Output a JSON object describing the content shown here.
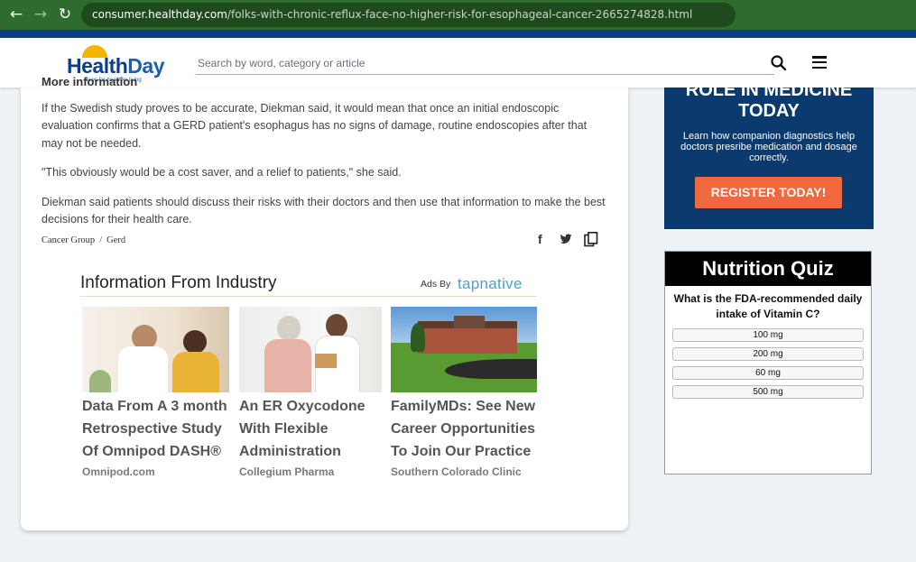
{
  "browser": {
    "url_host": "consumer.healthday.com",
    "url_path": "/folks-with-chronic-reflux-face-no-higher-risk-for-esophageal-cancer-2665274828.html"
  },
  "header": {
    "logo_health": "Health",
    "logo_day": "Day",
    "logo_tagline": "News for healthier living",
    "search_placeholder": "Search by word, category or article"
  },
  "article": {
    "cut_heading": "More information",
    "paragraphs": [
      "If the Swedish study proves to be accurate, Diekman said, it would mean that once an initial endoscopic evaluation confirms that a GERD patient's esophagus has no signs of damage, routine endoscopies after that may not be needed.",
      "\"This obviously would be a cost saver, and a relief to patients,\" she said.",
      "Diekman said patients should discuss their risks with their doctors and then use that information to make the best decisions for their health care."
    ],
    "tags": [
      "Cancer Group",
      "Gerd"
    ],
    "tag_separator": "/"
  },
  "ads": {
    "title": "Information From Industry",
    "ads_by": "Ads By",
    "brand": "tapnative",
    "items": [
      {
        "title": "Data From A 3 month Retrospective Study Of Omnipod DASH®",
        "source": "Omnipod.com"
      },
      {
        "title": "An ER Oxycodone With Flexible Administration",
        "source": "Collegium Pharma"
      },
      {
        "title": "FamilyMDs: See New Career Opportunities To Join Our Practice",
        "source": "Southern Colorado Clinic"
      }
    ]
  },
  "promo": {
    "heading": "ROLE IN MEDICINE TODAY",
    "body": "Learn how companion diagnostics help doctors presribe medication and dosage correctly.",
    "button": "REGISTER TODAY!"
  },
  "quiz": {
    "title": "Nutrition Quiz",
    "question": "What is the FDA-recommended daily intake of Vitamin C?",
    "options": [
      "100 mg",
      "200 mg",
      "60 mg",
      "500 mg"
    ]
  },
  "colors": {
    "browser_bar": "#2f6b2c",
    "brand_blue": "#0b3f86",
    "promo_bg": "#0b3a6e",
    "cta_orange": "#f0693d"
  }
}
